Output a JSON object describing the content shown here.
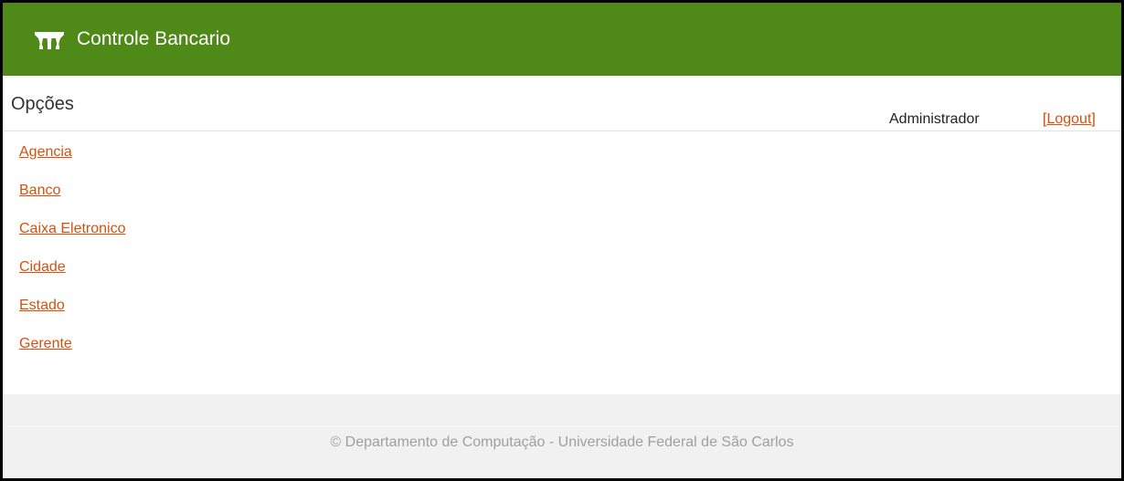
{
  "header": {
    "app_title": "Controle Bancario",
    "logo_icon": "bank-logo-icon",
    "background_color": "#4f8a19"
  },
  "sidebar": {
    "heading": "Opções",
    "items": [
      {
        "label": "Agencia"
      },
      {
        "label": "Banco"
      },
      {
        "label": "Caixa Eletronico"
      },
      {
        "label": "Cidade"
      },
      {
        "label": "Estado"
      },
      {
        "label": "Gerente"
      }
    ]
  },
  "user": {
    "name": "Administrador",
    "logout_open": "[",
    "logout_label": "Logout",
    "logout_close": "]"
  },
  "footer": {
    "text": "© Departamento de Computação - Universidade Federal de São Carlos"
  },
  "colors": {
    "link": "#d4520e",
    "footer_bg": "#f1f1f1"
  }
}
